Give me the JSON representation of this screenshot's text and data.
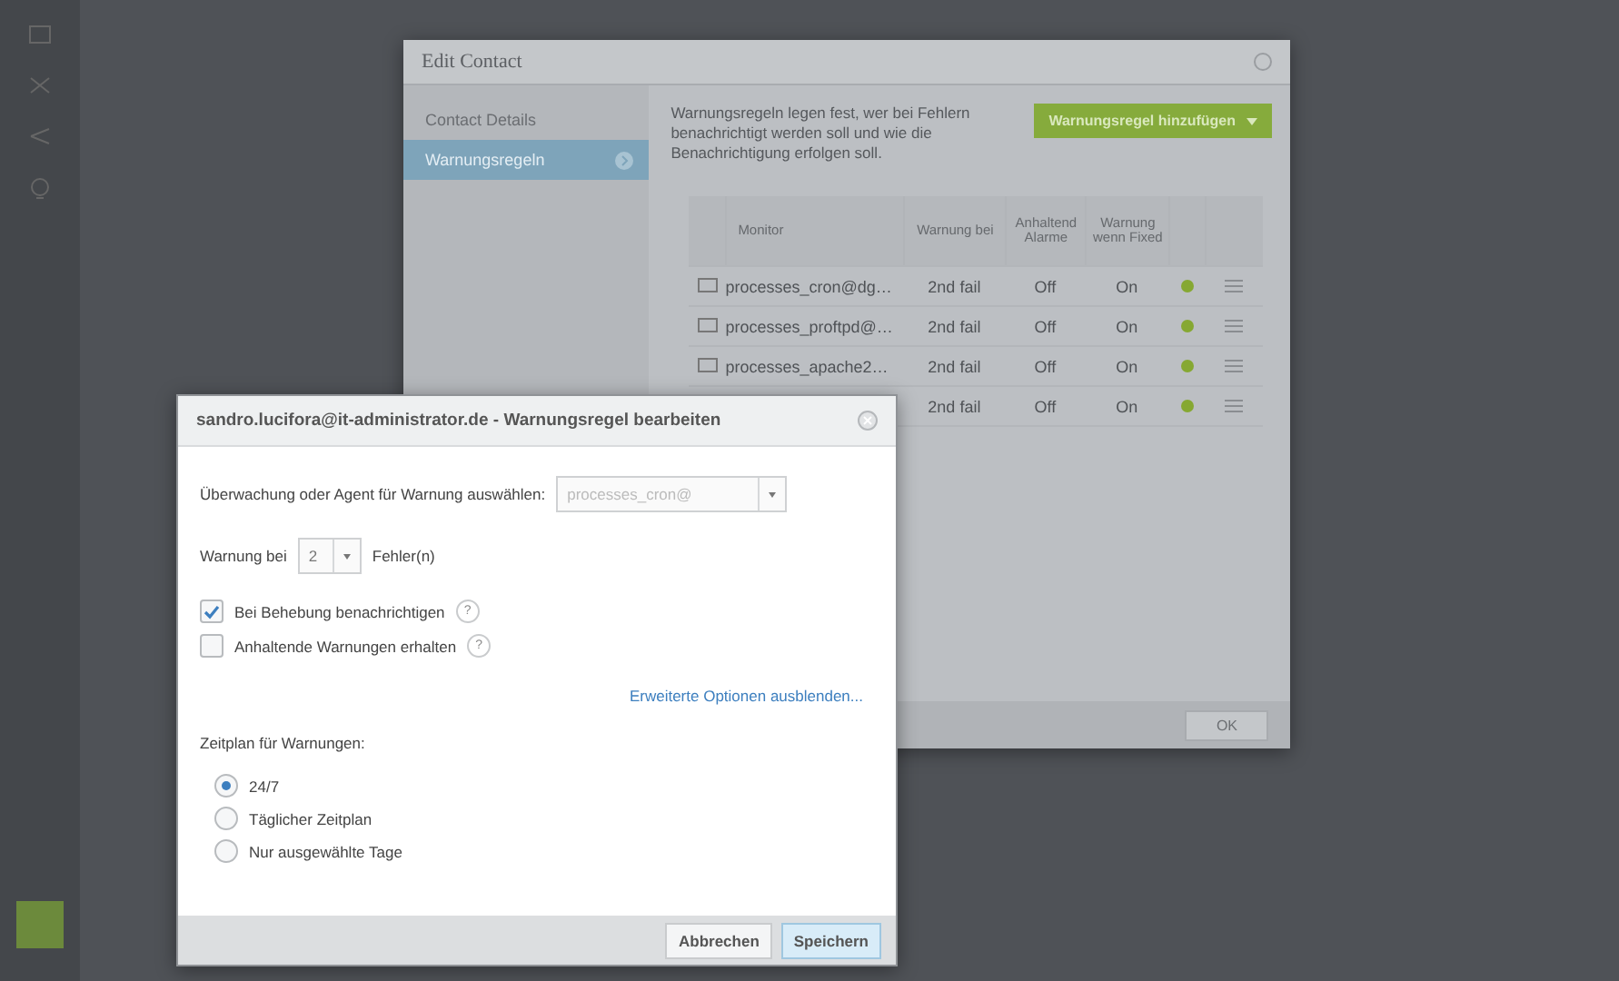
{
  "edit_contact": {
    "title": "Edit Contact",
    "sidebar": [
      {
        "label": "Contact Details",
        "selected": false
      },
      {
        "label": "Warnungsregeln",
        "selected": true
      }
    ],
    "intro": "Warnungsregeln legen fest, wer bei Fehlern benachrichtigt werden soll und wie die Benachrichtigung erfolgen soll.",
    "add_button": "Warnungsregel hinzufügen",
    "columns": [
      "Monitor",
      "Warnung bei",
      "Anhaltend Alarme",
      "Warnung wenn Fixed"
    ],
    "rows": [
      {
        "monitor": "processes_cron@dg…",
        "alert_at": "2nd fail",
        "persistent": "Off",
        "on_fixed": "On",
        "color": "#86a832"
      },
      {
        "monitor": "processes_proftpd@…",
        "alert_at": "2nd fail",
        "persistent": "Off",
        "on_fixed": "On",
        "color": "#86a832"
      },
      {
        "monitor": "processes_apache2…",
        "alert_at": "2nd fail",
        "persistent": "Off",
        "on_fixed": "On",
        "color": "#86a832"
      },
      {
        "alert_at": "2nd fail",
        "persistent": "Off",
        "on_fixed": "On",
        "color": "#86a832"
      }
    ],
    "ok_button": "OK"
  },
  "rule_dialog": {
    "title": "sandro.lucifora@it-administrator.de - Warnungsregel bearbeiten",
    "monitor_label": "Überwachung oder Agent für Warnung auswählen:",
    "monitor_value": "processes_cron@",
    "alert_label": "Warnung bei",
    "alert_value": "2",
    "alert_suffix": "Fehler(n)",
    "checkboxes": [
      {
        "label": "Bei Behebung benachrichtigen",
        "checked": true,
        "help": "?"
      },
      {
        "label": "Anhaltende Warnungen erhalten",
        "checked": false,
        "help": "?"
      }
    ],
    "advanced_link": "Erweiterte Optionen ausblenden...",
    "schedule_label": "Zeitplan für Warnungen:",
    "schedule": [
      {
        "label": "24/7",
        "selected": true
      },
      {
        "label": "Täglicher Zeitplan",
        "selected": false
      },
      {
        "label": "Nur ausgewählte Tage",
        "selected": false
      }
    ],
    "cancel_button": "Abbrechen",
    "save_button": "Speichern"
  }
}
